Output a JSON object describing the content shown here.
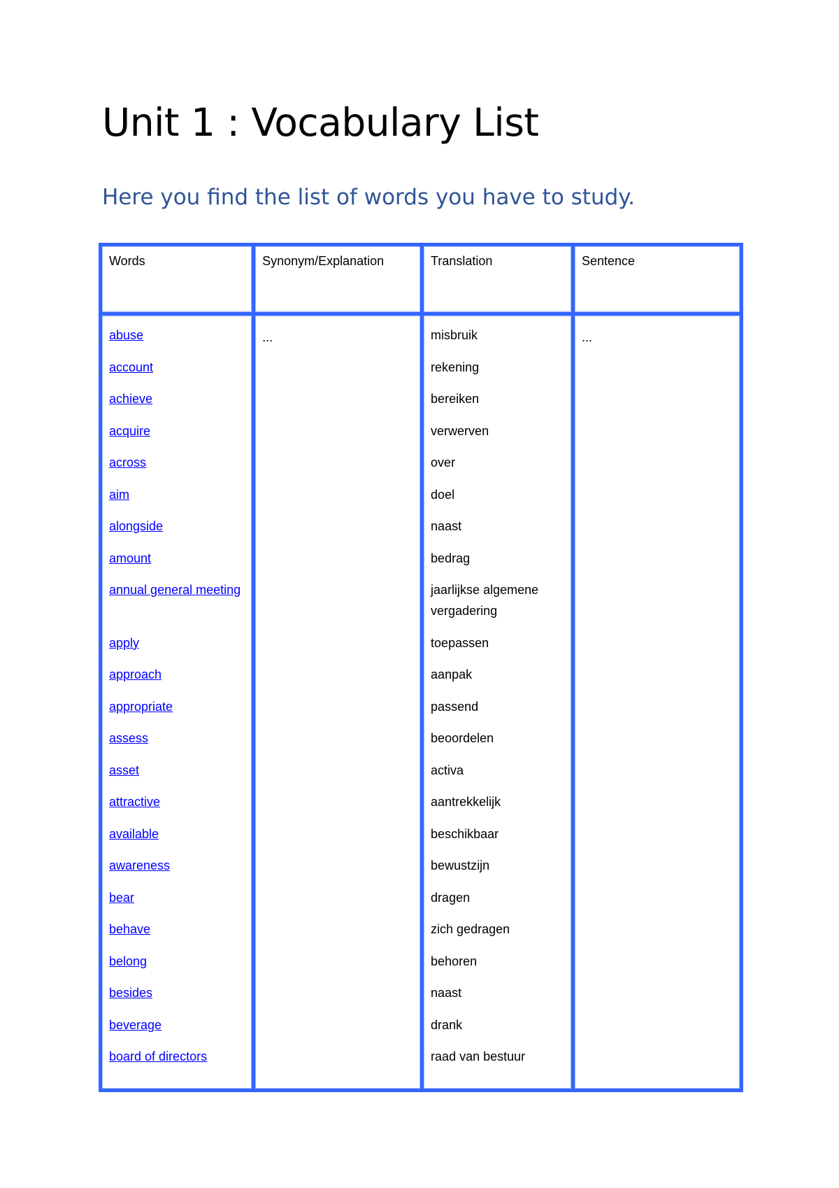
{
  "document": {
    "title": "Unit 1 : Vocabulary List",
    "subtitle": "Here you find the list of words you have to study.",
    "colors": {
      "title": "#000000",
      "subtitle": "#2f5597",
      "table_border": "#3366ff",
      "link": "#0000ff"
    }
  },
  "table": {
    "headers": {
      "words": "Words",
      "synonym": "Synonym/Explanation",
      "translation": "Translation",
      "sentence": "Sentence"
    },
    "synonym_placeholder": "...",
    "sentence_placeholder": "...",
    "rows": [
      {
        "word": "abuse",
        "translation": "misbruik"
      },
      {
        "word": "account",
        "translation": "rekening"
      },
      {
        "word": "achieve",
        "translation": "bereiken"
      },
      {
        "word": "acquire",
        "translation": "verwerven"
      },
      {
        "word": "across",
        "translation": "over"
      },
      {
        "word": "aim",
        "translation": "doel"
      },
      {
        "word": "alongside",
        "translation": "naast"
      },
      {
        "word": "amount",
        "translation": "bedrag"
      },
      {
        "word": "annual general meeting",
        "translation": "jaarlijkse algemene vergadering"
      },
      {
        "word": "apply",
        "translation": "toepassen"
      },
      {
        "word": "approach",
        "translation": "aanpak"
      },
      {
        "word": "appropriate",
        "translation": "passend"
      },
      {
        "word": "assess",
        "translation": "beoordelen"
      },
      {
        "word": "asset",
        "translation": "activa"
      },
      {
        "word": "attractive",
        "translation": "aantrekkelijk"
      },
      {
        "word": "available",
        "translation": "beschikbaar"
      },
      {
        "word": "awareness",
        "translation": "bewustzijn"
      },
      {
        "word": "bear",
        "translation": "dragen"
      },
      {
        "word": "behave",
        "translation": "zich gedragen"
      },
      {
        "word": "belong",
        "translation": "behoren"
      },
      {
        "word": "besides",
        "translation": "naast"
      },
      {
        "word": "beverage",
        "translation": "drank"
      },
      {
        "word": "board of directors",
        "translation": "raad van bestuur"
      }
    ]
  }
}
